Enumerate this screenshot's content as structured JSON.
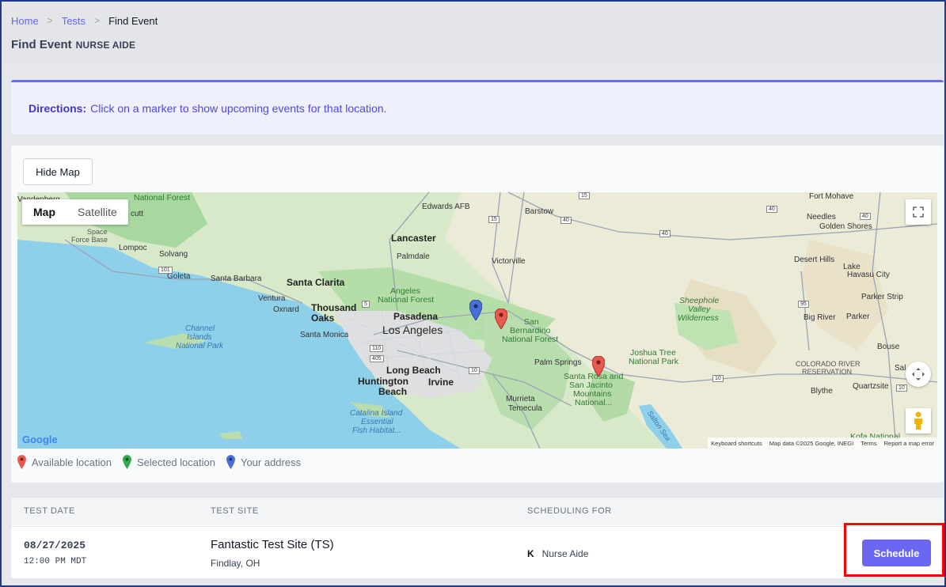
{
  "breadcrumb": {
    "home": "Home",
    "tests": "Tests",
    "current": "Find Event",
    "separator": ">"
  },
  "page": {
    "title": "Find Event",
    "subtitle": "NURSE AIDE"
  },
  "directions": {
    "label": "Directions:",
    "text": "Click on a marker to show upcoming events for that location."
  },
  "map_card": {
    "hide_map_label": "Hide Map",
    "map_type": {
      "map": "Map",
      "satellite": "Satellite"
    },
    "google": "Google",
    "attribution": {
      "shortcuts": "Keyboard shortcuts",
      "data": "Map data ©2025 Google, INEGI",
      "terms": "Terms",
      "report": "Report a map error"
    },
    "places": {
      "national_forest": "National Forest",
      "cutt": "cutt",
      "space": "Space",
      "force_base": "Force Base",
      "lompoc": "Lompoc",
      "solvang": "Solvang",
      "goleta": "Goleta",
      "santa_barbara": "Santa Barbara",
      "santa_clarita": "Santa Clarita",
      "ventura": "Ventura",
      "oxnard": "Oxnard",
      "thousand": "Thousand",
      "oaks": "Oaks",
      "channel": "Channel",
      "islands": "Islands",
      "national_park": "National Park",
      "santa_monica": "Santa Monica",
      "los_angeles": "Los Angeles",
      "pasadena": "Pasadena",
      "angeles": "Angeles",
      "angeles_nf": "National Forest",
      "long_beach": "Long Beach",
      "huntington": "Huntington",
      "beach": "Beach",
      "irvine": "Irvine",
      "catalina": "Catalina Island",
      "essential": "Essential",
      "fish_habitat": "Fish Habitat...",
      "edwards": "Edwards AFB",
      "lancaster": "Lancaster",
      "palmdale": "Palmdale",
      "victorville": "Victorville",
      "barstow": "Barstow",
      "san": "San",
      "bernardino": "Bernardino",
      "sb_nf": "National Forest",
      "palm_springs": "Palm Springs",
      "santa_rosa": "Santa Rosa and",
      "san_jacinto": "San Jacinto",
      "mountains": "Mountains",
      "national_dots": "National...",
      "murrieta": "Murrieta",
      "temecula": "Temecula",
      "joshua": "Joshua Tree",
      "joshua_np": "National Park",
      "salton": "Salton Sea",
      "sheephole": "Sheephole",
      "valley": "Valley",
      "wilderness": "Wilderness",
      "needles": "Needles",
      "golden_shores": "Golden Shores",
      "desert_hills": "Desert Hills",
      "lake": "Lake",
      "havasu": "Havasu City",
      "parker_strip": "Parker Strip",
      "big_river": "Big River",
      "parker": "Parker",
      "bouse": "Bouse",
      "colorado": "COLORADO RIVER",
      "reservation": "RESERVATION",
      "quartzsite": "Quartzsite",
      "blythe": "Blythe",
      "sal": "Sal",
      "kofa": "Kofa National",
      "fort_mohave": "Fort Mohave",
      "vandenberg": "Vandenberg"
    },
    "highways": {
      "h15a": "15",
      "h15b": "15",
      "h40a": "40",
      "h40b": "40",
      "h40c": "40",
      "h40d": "40",
      "h101": "101",
      "h5": "5",
      "h110": "110",
      "h405": "405",
      "h10a": "10",
      "h10b": "10",
      "h10c": "10",
      "h95": "95"
    },
    "legend": {
      "available": "Available location",
      "selected": "Selected location",
      "your_address": "Your address"
    },
    "colors": {
      "available": "#e85a4f",
      "selected": "#34a853",
      "your_address": "#4a6fd8"
    }
  },
  "table": {
    "headers": {
      "test_date": "TEST DATE",
      "test_site": "TEST SITE",
      "scheduling_for": "SCHEDULING FOR"
    },
    "rows": [
      {
        "date": "08/27/2025",
        "time": "12:00 PM MDT",
        "site": "Fantastic Test Site (TS)",
        "city": "Findlay, OH",
        "sched_code": "K",
        "sched_name": "Nurse Aide",
        "action": "Schedule"
      }
    ]
  }
}
